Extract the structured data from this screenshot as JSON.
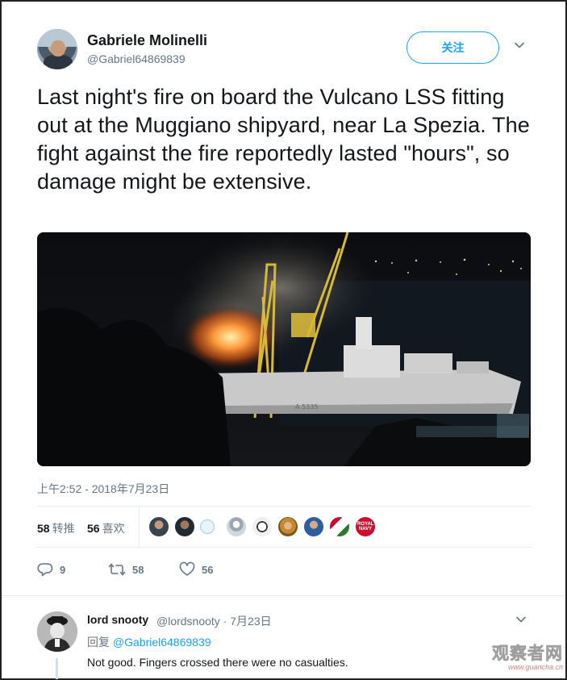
{
  "tweet": {
    "author_name": "Gabriele Molinelli",
    "author_handle": "@Gabriel64869839",
    "follow_label": "关注",
    "text": "Last night's fire on board the Vulcano LSS fitting out at the Muggiano shipyard, near La Spezia. The fight against the fire reportedly lasted \"hours\", so damage might be extensive.",
    "timestamp": "上午2:52 - 2018年7月23日",
    "image_text": "A 5335"
  },
  "stats": {
    "retweets_count": "58",
    "retweets_label": "转推",
    "likes_count": "56",
    "likes_label": "喜欢",
    "liker_badge_text": "ROYAL NAVY"
  },
  "actions": {
    "reply_icon": "reply-icon",
    "reply_count": "9",
    "retweet_icon": "retweet-icon",
    "retweet_count": "58",
    "like_icon": "heart-icon",
    "like_count": "56"
  },
  "reply": {
    "author_name": "lord snooty",
    "author_handle_date": "@lordsnooty · 7月23日",
    "replying_prefix": "回复",
    "replying_handle": "@Gabriel64869839",
    "text": "Not good. Fingers crossed there were no casualties."
  },
  "watermark": {
    "title": "观察者网",
    "url": "www.guancha.cn"
  },
  "colors": {
    "accent": "#1da1f2",
    "muted": "#657786",
    "text": "#14171a",
    "divider": "#e6ecf0"
  }
}
